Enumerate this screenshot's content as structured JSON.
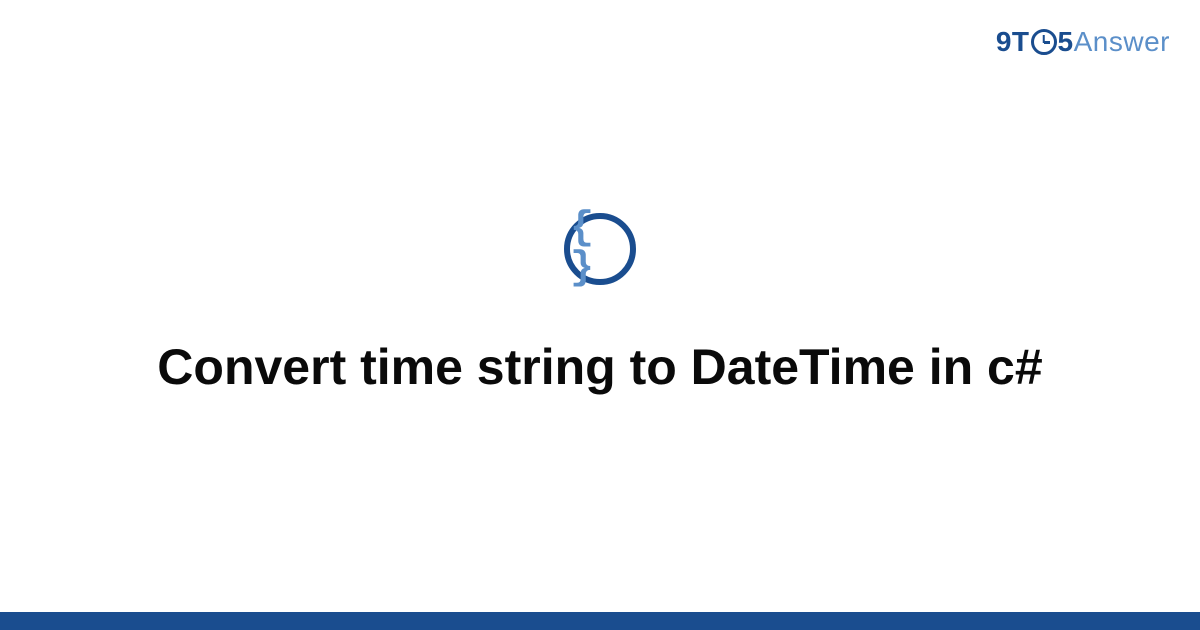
{
  "brand": {
    "part1": "9T",
    "part2": "5",
    "part3": "Answer"
  },
  "icon": {
    "braces": "{ }"
  },
  "title": "Convert time string to DateTime in c#"
}
